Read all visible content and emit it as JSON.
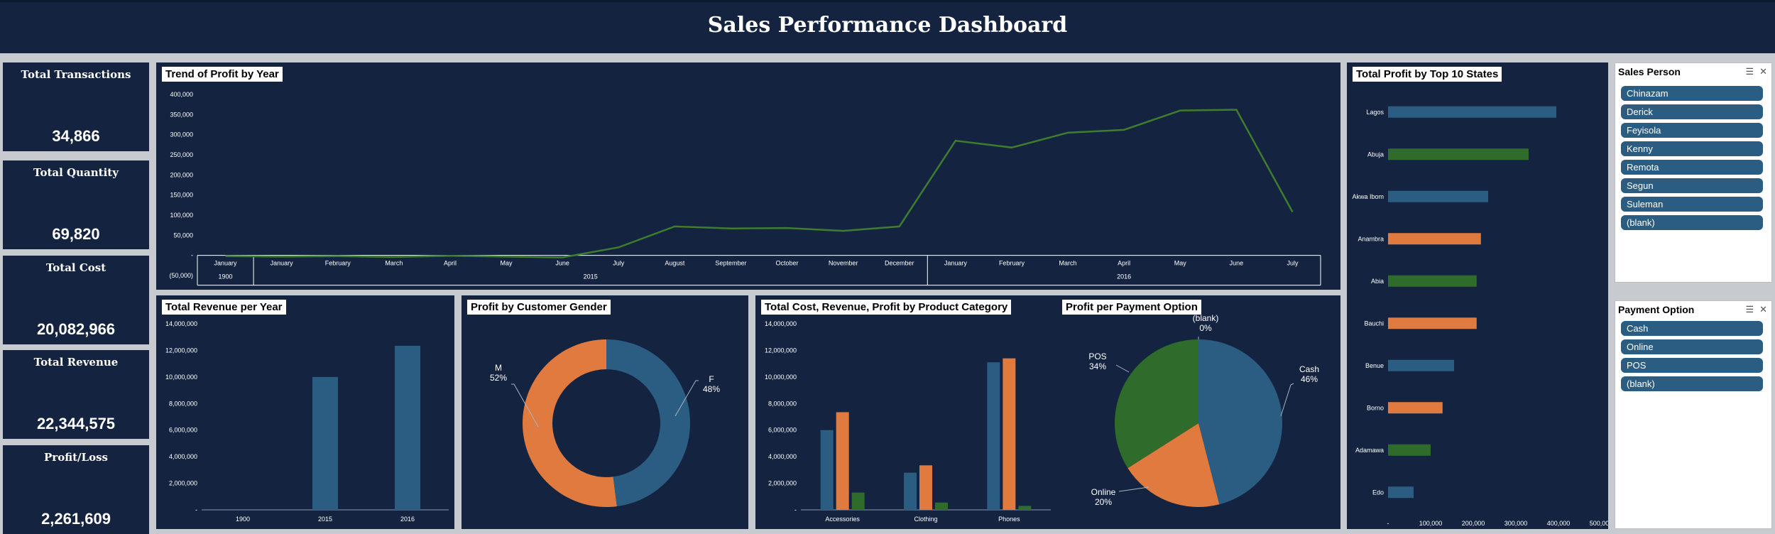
{
  "dashboard_title": "Sales Performance Dashboard",
  "kpis": [
    {
      "label": "Total Transactions",
      "value": "34,866"
    },
    {
      "label": "Total Quantity",
      "value": "69,820"
    },
    {
      "label": "Total Cost",
      "value": "20,082,966"
    },
    {
      "label": "Total Revenue",
      "value": "22,344,575"
    },
    {
      "label": "Profit/Loss",
      "value": "2,261,609"
    }
  ],
  "colors": {
    "blue": "#2b5d82",
    "orange": "#e07a3f",
    "green": "#2f6b2b",
    "line": "#3e7d2d",
    "panel": "#142440"
  },
  "chart_data": [
    {
      "id": "trend",
      "type": "line",
      "title": "Trend of Profit by Year",
      "months": [
        "January",
        "January",
        "February",
        "March",
        "April",
        "May",
        "June",
        "July",
        "August",
        "September",
        "October",
        "November",
        "December",
        "January",
        "February",
        "March",
        "April",
        "May",
        "June",
        "July"
      ],
      "years": [
        {
          "label": "1900",
          "span": [
            0,
            0
          ]
        },
        {
          "label": "2015",
          "span": [
            1,
            12
          ]
        },
        {
          "label": "2016",
          "span": [
            13,
            19
          ]
        }
      ],
      "values": [
        -2000,
        -3000,
        -2000,
        -4000,
        -1000,
        -3000,
        -5000,
        20000,
        72000,
        67000,
        68000,
        61000,
        72000,
        285000,
        268000,
        305000,
        312000,
        360000,
        362000,
        108000
      ],
      "ylim": [
        -50000,
        400000
      ],
      "yticks": [
        "400,000",
        "350,000",
        "300,000",
        "250,000",
        "200,000",
        "150,000",
        "100,000",
        "50,000",
        "-",
        "(50,000)"
      ]
    },
    {
      "id": "states",
      "type": "bar",
      "orientation": "horizontal",
      "title": "Total Profit by Top 10 States",
      "categories": [
        "Lagos",
        "Abuja",
        "Akwa Ibom",
        "Anambra",
        "Abia",
        "Bauchi",
        "Benue",
        "Borno",
        "Adamawa",
        "Edo"
      ],
      "values": [
        395000,
        330000,
        235000,
        218000,
        208000,
        208000,
        155000,
        128000,
        100000,
        60000
      ],
      "bar_colors": [
        "blue",
        "green",
        "blue",
        "orange",
        "green",
        "orange",
        "blue",
        "orange",
        "green",
        "blue"
      ],
      "xlim": [
        0,
        500000
      ],
      "xticks": [
        "-",
        "100,000",
        "200,000",
        "300,000",
        "400,000",
        "500,000"
      ]
    },
    {
      "id": "revenue",
      "type": "bar",
      "title": "Total Revenue per Year",
      "categories": [
        "1900",
        "2015",
        "2016"
      ],
      "values": [
        0,
        10000000,
        12350000
      ],
      "ylim": [
        0,
        14000000
      ],
      "yticks": [
        "14,000,000",
        "12,000,000",
        "10,000,000",
        "8,000,000",
        "6,000,000",
        "4,000,000",
        "2,000,000",
        "-"
      ]
    },
    {
      "id": "gender",
      "type": "pie",
      "title": "Profit by Customer Gender",
      "slices": [
        {
          "label": "F",
          "pct": "48%",
          "value": 48,
          "color": "blue"
        },
        {
          "label": "M",
          "pct": "52%",
          "value": 52,
          "color": "orange"
        }
      ]
    },
    {
      "id": "category",
      "type": "bar",
      "title": "Total Cost, Revenue, Profit by Product Category",
      "categories": [
        "Accessories",
        "Clothing",
        "Phones"
      ],
      "series": [
        {
          "values": [
            6000000,
            2800000,
            11100000
          ],
          "color": "blue"
        },
        {
          "values": [
            7350000,
            3350000,
            11400000
          ],
          "color": "orange"
        },
        {
          "values": [
            1300000,
            550000,
            300000
          ],
          "color": "green"
        }
      ],
      "ylim": [
        0,
        14000000
      ],
      "yticks": [
        "14,000,000",
        "12,000,000",
        "10,000,000",
        "8,000,000",
        "6,000,000",
        "4,000,000",
        "2,000,000",
        "-"
      ]
    },
    {
      "id": "payment",
      "type": "pie",
      "title": "Profit per Payment Option",
      "slices": [
        {
          "label": "Cash",
          "pct": "46%",
          "value": 46,
          "color": "blue"
        },
        {
          "label": "Online",
          "pct": "20%",
          "value": 20,
          "color": "orange"
        },
        {
          "label": "POS",
          "pct": "34%",
          "value": 34,
          "color": "green"
        },
        {
          "label": "(blank)",
          "pct": "0%",
          "value": 0,
          "color": "blue"
        }
      ]
    }
  ],
  "slicers": {
    "sales_person": {
      "title": "Sales Person",
      "items": [
        "Chinazam",
        "Derick",
        "Feyisola",
        "Kenny",
        "Remota",
        "Segun",
        "Suleman",
        "(blank)"
      ]
    },
    "payment_option": {
      "title": "Payment Option",
      "items": [
        "Cash",
        "Online",
        "POS",
        "(blank)"
      ]
    }
  }
}
